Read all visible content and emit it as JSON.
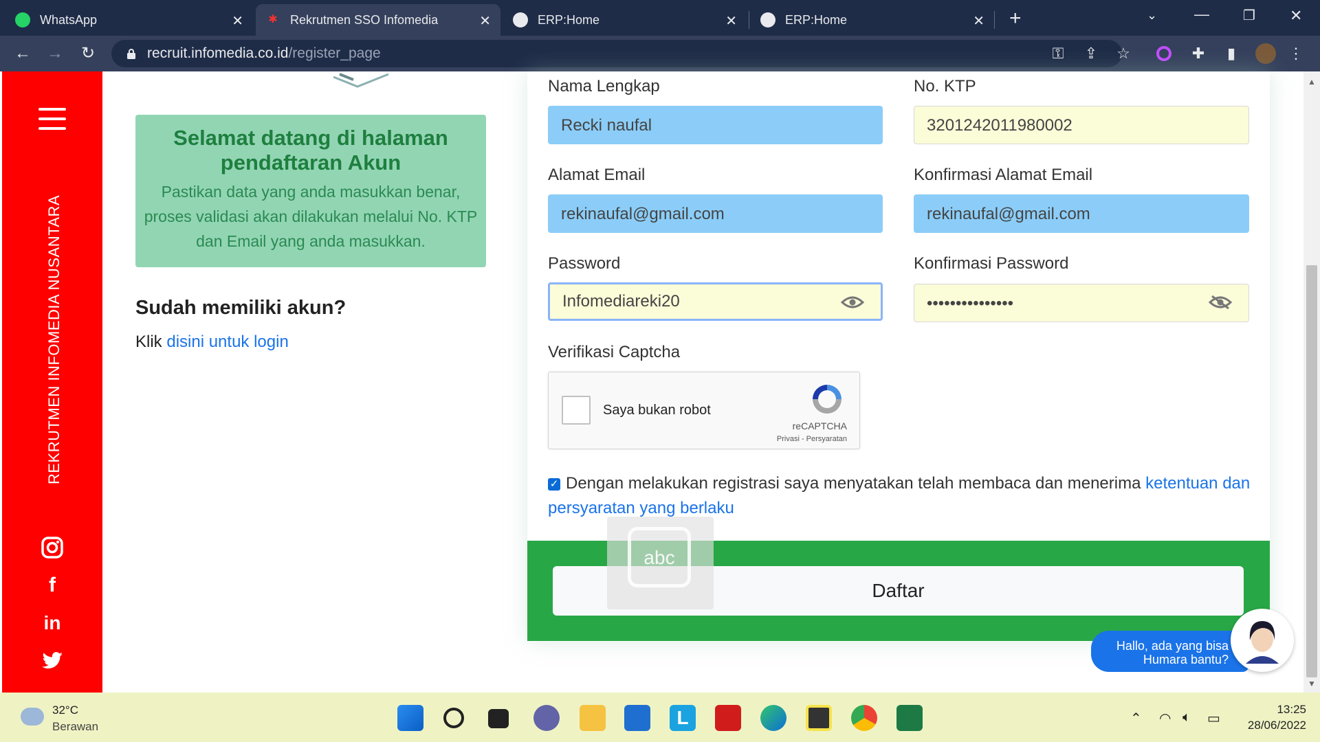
{
  "browser": {
    "tabs": [
      {
        "title": "WhatsApp",
        "icon": "whatsapp-icon",
        "active": false
      },
      {
        "title": "Rekrutmen SSO Infomedia",
        "icon": "infomedia-favicon",
        "active": true
      },
      {
        "title": "ERP:Home",
        "icon": "globe-icon",
        "active": false
      },
      {
        "title": "ERP:Home",
        "icon": "globe-icon",
        "active": false
      }
    ],
    "url_domain": "recruit.infomedia.co.id",
    "url_path": "/register_page"
  },
  "sidebar": {
    "vertical_title": "REKRUTMEN INFOMEDIA NUSANTARA",
    "socials": [
      "instagram-icon",
      "facebook-icon",
      "linkedin-icon",
      "twitter-icon"
    ],
    "color": "#fe0000"
  },
  "welcome": {
    "title": "Selamat datang di halaman pendaftaran Akun",
    "body": "Pastikan data yang anda masukkan benar, proses validasi akan dilakukan melalui No. KTP dan Email yang anda masukkan."
  },
  "login": {
    "heading": "Sudah memiliki akun?",
    "prefix": "Klik",
    "link": "disini untuk login"
  },
  "form": {
    "nama_label": "Nama Lengkap",
    "nama_value": "Recki naufal",
    "ktp_label": "No. KTP",
    "ktp_value": "3201242011980002",
    "email_label": "Alamat Email",
    "email_value": "rekinaufal@gmail.com",
    "email_confirm_label": "Konfirmasi Alamat Email",
    "email_confirm_value": "rekinaufal@gmail.com",
    "password_label": "Password",
    "password_value": "Infomediareki20",
    "password_confirm_label": "Konfirmasi Password",
    "password_confirm_value": "•••••••••••••••",
    "captcha_label": "Verifikasi Captcha",
    "captcha_text": "Saya bukan robot",
    "captcha_brand": "reCAPTCHA",
    "captcha_terms": "Privasi - Persyaratan",
    "terms_text": "Dengan melakukan registrasi saya menyatakan telah membaca dan menerima",
    "terms_link": "ketentuan dan persyaratan yang berlaku",
    "submit_label": "Daftar"
  },
  "overlay": {
    "abc_label": "abc",
    "chat_text": "Hallo, ada yang bisa Humara bantu?"
  },
  "taskbar": {
    "weather_temp": "32°C",
    "weather_desc": "Berawan",
    "time": "13:25",
    "date": "28/06/2022"
  }
}
